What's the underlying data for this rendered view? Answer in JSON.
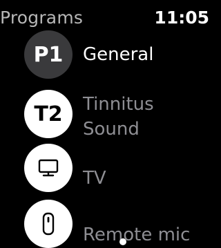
{
  "status_bar": {
    "title": "Programs",
    "time": "11:05"
  },
  "programs": [
    {
      "badge": "P1",
      "label": "General",
      "state": "active"
    },
    {
      "badge": "T2",
      "label_line1": "Tinnitus",
      "label_line2": "Sound"
    },
    {
      "badge_icon": "tv-icon",
      "label": "TV"
    },
    {
      "badge_icon": "remote-mic-icon",
      "label": "Remote mic"
    }
  ],
  "colors": {
    "background": "#000000",
    "active_badge": "#3a3a3c",
    "inactive_badge": "#ffffff",
    "title": "#b7b7b7",
    "inactive_label": "#8e8e93"
  }
}
